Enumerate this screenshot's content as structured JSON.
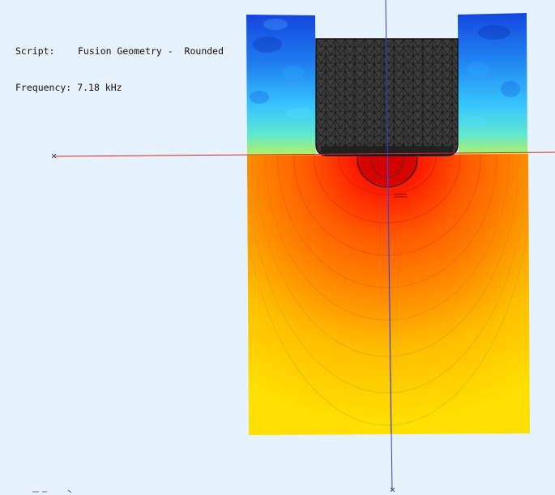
{
  "info": {
    "script_label": "Script:",
    "script_value": "Fusion Geometry -  Rounded",
    "frequency_label": "Frequency:",
    "frequency_value": "7.18 kHz"
  },
  "colors": {
    "background": "#e6f2fc",
    "axis_horizontal": "#e0202a",
    "axis_vertical": "#3a3ad8",
    "mesh_fill": "#3a3a3a",
    "mesh_line": "#111111",
    "field_hot": "#e01010",
    "field_warm": "#ff7a00",
    "field_mid": "#ffd000",
    "field_cool": "#3fd6ff",
    "field_cold": "#1a4fe0"
  }
}
